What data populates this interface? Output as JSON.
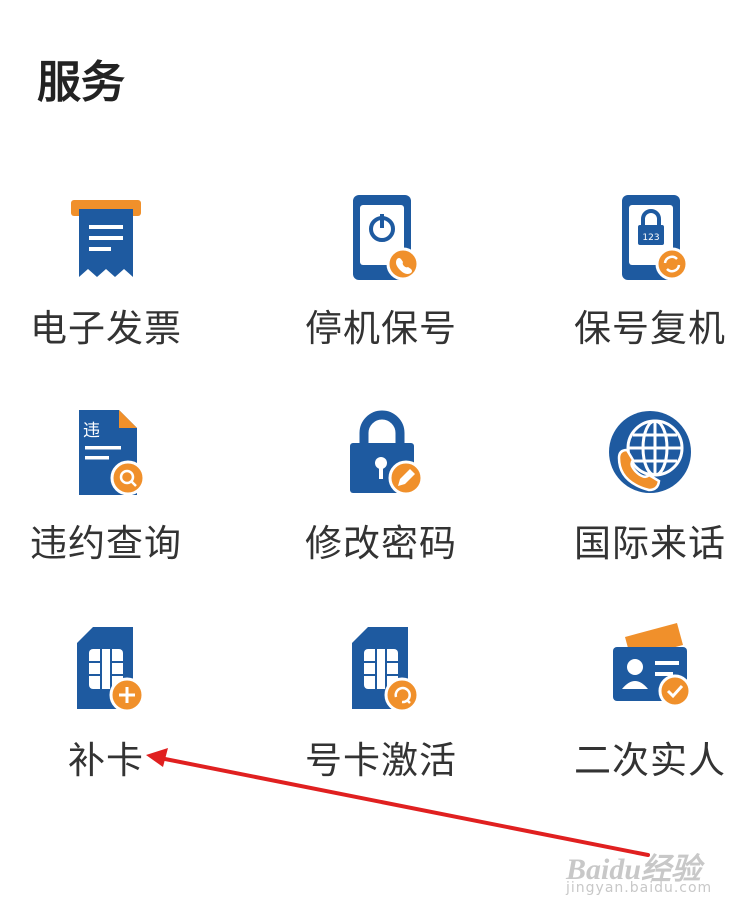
{
  "section": {
    "title": "服务"
  },
  "services": [
    {
      "label": "电子发票",
      "icon": "e-invoice-icon"
    },
    {
      "label": "停机保号",
      "icon": "phone-power-icon"
    },
    {
      "label": "保号复机",
      "icon": "phone-lock-restore-icon"
    },
    {
      "label": "违约查询",
      "icon": "violation-document-search-icon"
    },
    {
      "label": "修改密码",
      "icon": "lock-edit-icon"
    },
    {
      "label": "国际来话",
      "icon": "globe-phone-icon"
    },
    {
      "label": "补卡",
      "icon": "sim-add-icon"
    },
    {
      "label": "号卡激活",
      "icon": "sim-activate-icon"
    },
    {
      "label": "二次实人",
      "icon": "id-card-verify-icon"
    }
  ],
  "watermark": {
    "brand": "Baidu经验",
    "url": "jingyan.baidu.com"
  },
  "colors": {
    "primary": "#1e5aa0",
    "accent": "#f0902b",
    "annotation": "#e02020"
  }
}
